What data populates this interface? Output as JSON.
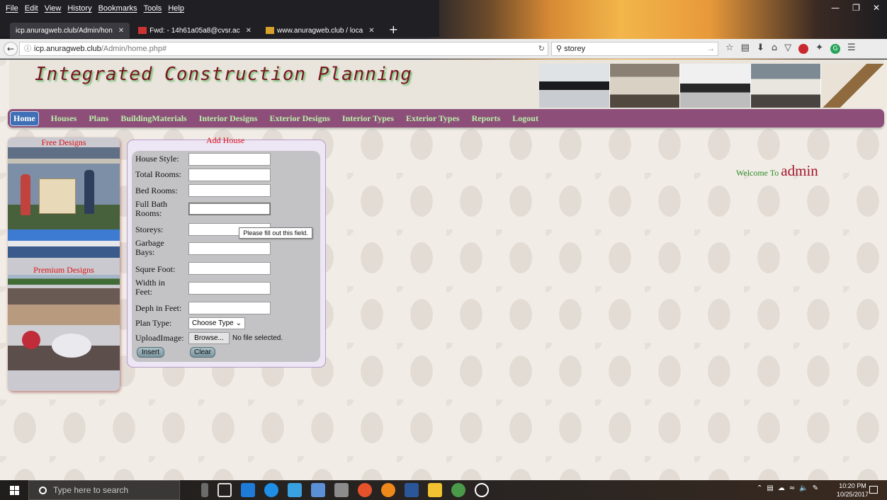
{
  "browser": {
    "menu": [
      "File",
      "Edit",
      "View",
      "History",
      "Bookmarks",
      "Tools",
      "Help"
    ],
    "tabs": [
      {
        "label": "icp.anuragweb.club/Admin/hon"
      },
      {
        "label": "Fwd: - 14h61a05a8@cvsr.ac"
      },
      {
        "label": "www.anuragweb.club / loca"
      }
    ],
    "new_tab": "+",
    "url_host": "icp.anuragweb.club",
    "url_path": "/Admin/home.php#",
    "search_value": "storey"
  },
  "site": {
    "title": "Integrated Construction Planning"
  },
  "nav": {
    "items": [
      "Home",
      "Houses",
      "Plans",
      "BuildingMaterials",
      "Interior Designs",
      "Exterior Designs",
      "Interior Types",
      "Exterior Types",
      "Reports",
      "Logout"
    ],
    "active": "Home"
  },
  "sidebar": {
    "free_heading": "Free Designs",
    "premium_heading": "Premium Designs"
  },
  "form": {
    "legend": "Add House",
    "fields": [
      {
        "label": "House Style:",
        "value": ""
      },
      {
        "label": "Total Rooms:",
        "value": ""
      },
      {
        "label": "Bed Rooms:",
        "value": ""
      },
      {
        "label": "Full Bath Rooms:",
        "value": ""
      },
      {
        "label": "Storeys:",
        "value": ""
      },
      {
        "label": "Garbage Bays:",
        "value": ""
      },
      {
        "label": "Squre Foot:",
        "value": ""
      },
      {
        "label": "Width in Feet:",
        "value": ""
      },
      {
        "label": "Deph in Feet:",
        "value": ""
      }
    ],
    "plan_type_label": "Plan Type:",
    "plan_type_value": "Choose Type",
    "upload_label": "UploadImage:",
    "browse_label": "Browse...",
    "no_file": "No file selected.",
    "insert_label": "Insert",
    "clear_label": "Clear",
    "validation_tooltip": "Please fill out this field."
  },
  "welcome": {
    "prefix": "Welcome To",
    "user": "admin"
  },
  "taskbar": {
    "search_placeholder": "Type here to search",
    "time": "10:20 PM",
    "date": "10/25/2017"
  }
}
